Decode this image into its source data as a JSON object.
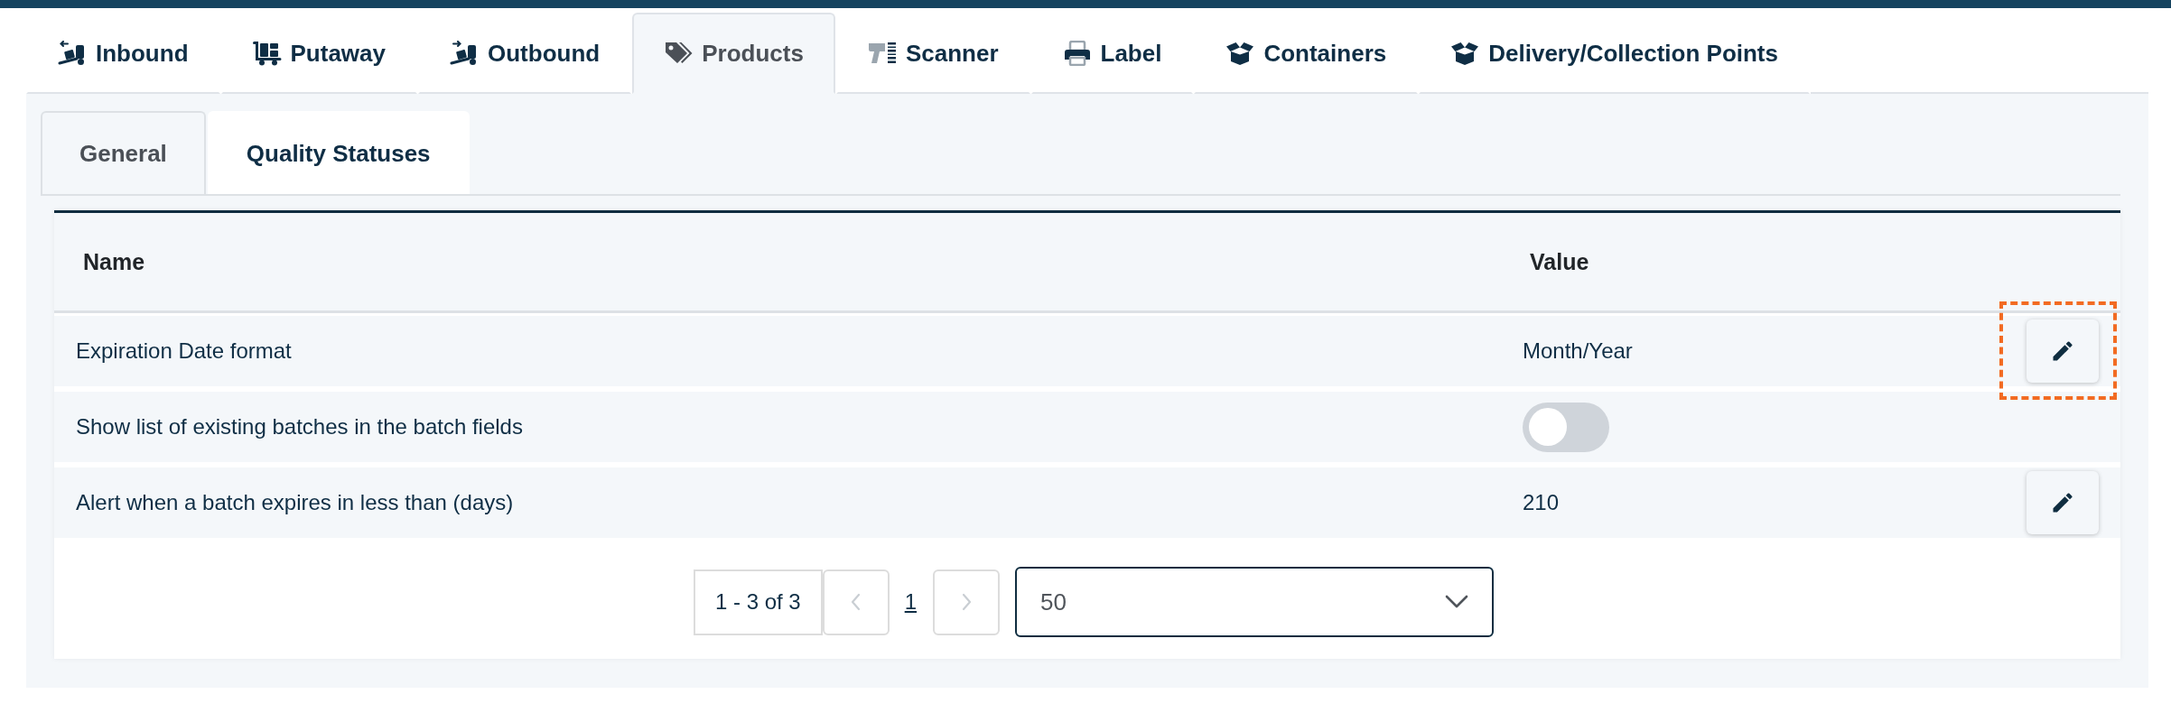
{
  "top_tabs": [
    {
      "label": "Inbound",
      "selected": false
    },
    {
      "label": "Putaway",
      "selected": false
    },
    {
      "label": "Outbound",
      "selected": false
    },
    {
      "label": "Products",
      "selected": true
    },
    {
      "label": "Scanner",
      "selected": false
    },
    {
      "label": "Label",
      "selected": false
    },
    {
      "label": "Containers",
      "selected": false
    },
    {
      "label": "Delivery/Collection Points",
      "selected": false
    }
  ],
  "sub_tabs": [
    {
      "label": "General",
      "selected": true
    },
    {
      "label": "Quality Statuses",
      "selected": false
    }
  ],
  "table": {
    "columns": [
      "Name",
      "Value"
    ],
    "rows": [
      {
        "name": "Expiration Date format",
        "kind": "text",
        "value": "Month/Year",
        "highlighted": true
      },
      {
        "name": "Show list of existing batches in the batch fields",
        "kind": "toggle",
        "on": false,
        "highlighted": false
      },
      {
        "name": "Alert when a batch expires in less than (days)",
        "kind": "text",
        "value": "210",
        "highlighted": false
      }
    ]
  },
  "pagination": {
    "range": "1 - 3 of 3",
    "prev": {
      "disabled": true
    },
    "pages": [
      {
        "label": "1",
        "selected": true
      }
    ],
    "next": {
      "disabled": true
    },
    "page_size": "50"
  }
}
